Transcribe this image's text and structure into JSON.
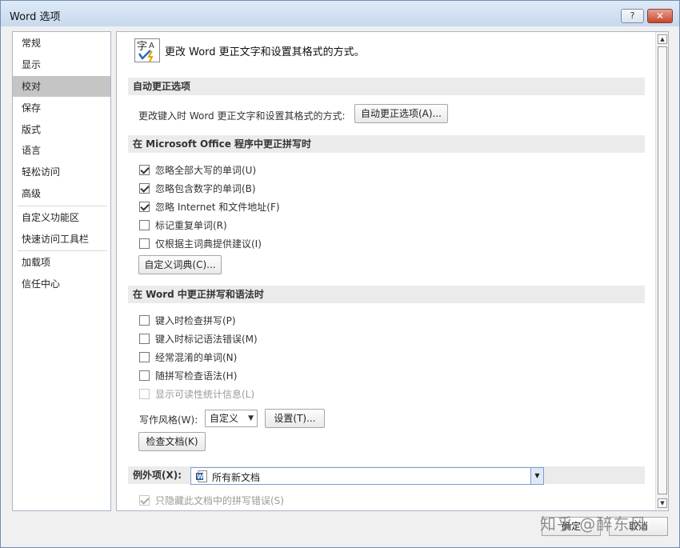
{
  "window": {
    "title": "Word 选项",
    "help_glyph": "?",
    "close_glyph": "✕"
  },
  "nav": {
    "items": [
      {
        "label": "常规"
      },
      {
        "label": "显示"
      },
      {
        "label": "校对"
      },
      {
        "label": "保存"
      },
      {
        "label": "版式"
      },
      {
        "label": "语言"
      },
      {
        "label": "轻松访问"
      },
      {
        "label": "高级"
      },
      {
        "label": "自定义功能区"
      },
      {
        "label": "快速访问工具栏"
      },
      {
        "label": "加载项"
      },
      {
        "label": "信任中心"
      }
    ],
    "active": "校对"
  },
  "header": {
    "icon": "proofing-abc-icon",
    "text": "更改 Word 更正文字和设置其格式的方式。"
  },
  "autocorrect": {
    "section_title": "自动更正选项",
    "row_label": "更改键入时 Word 更正文字和设置其格式的方式:",
    "button_label": "自动更正选项(A)..."
  },
  "office_spelling": {
    "section_title": "在 Microsoft Office 程序中更正拼写时",
    "options": [
      {
        "label": "忽略全部大写的单词(U)",
        "checked": true
      },
      {
        "label": "忽略包含数字的单词(B)",
        "checked": true
      },
      {
        "label": "忽略 Internet 和文件地址(F)",
        "checked": true
      },
      {
        "label": "标记重复单词(R)",
        "checked": false
      },
      {
        "label": "仅根据主词典提供建议(I)",
        "checked": false
      }
    ],
    "custom_dict_button": "自定义词典(C)..."
  },
  "word_spelling": {
    "section_title": "在 Word 中更正拼写和语法时",
    "options": [
      {
        "label": "键入时检查拼写(P)",
        "checked": false,
        "disabled": false
      },
      {
        "label": "键入时标记语法错误(M)",
        "checked": false,
        "disabled": false
      },
      {
        "label": "经常混淆的单词(N)",
        "checked": false,
        "disabled": false
      },
      {
        "label": "随拼写检查语法(H)",
        "checked": false,
        "disabled": false
      },
      {
        "label": "显示可读性统计信息(L)",
        "checked": false,
        "disabled": true
      }
    ],
    "writing_style_label": "写作风格(W):",
    "writing_style_value": "自定义",
    "settings_button": "设置(T)...",
    "check_doc_button": "检查文档(K)"
  },
  "exceptions": {
    "label": "例外项(X):",
    "value": "所有新文档",
    "hide_errors_label": "只隐藏此文档中的拼写错误(S)",
    "hide_errors_checked": true,
    "hide_errors_disabled": true
  },
  "footer": {
    "ok": "确定",
    "cancel": "取消"
  },
  "watermark": "知乎 @醉东风",
  "colors": {
    "accent": "#c5c5c5",
    "title_bar": "#c7d9ee",
    "close_button": "#c7452b"
  }
}
